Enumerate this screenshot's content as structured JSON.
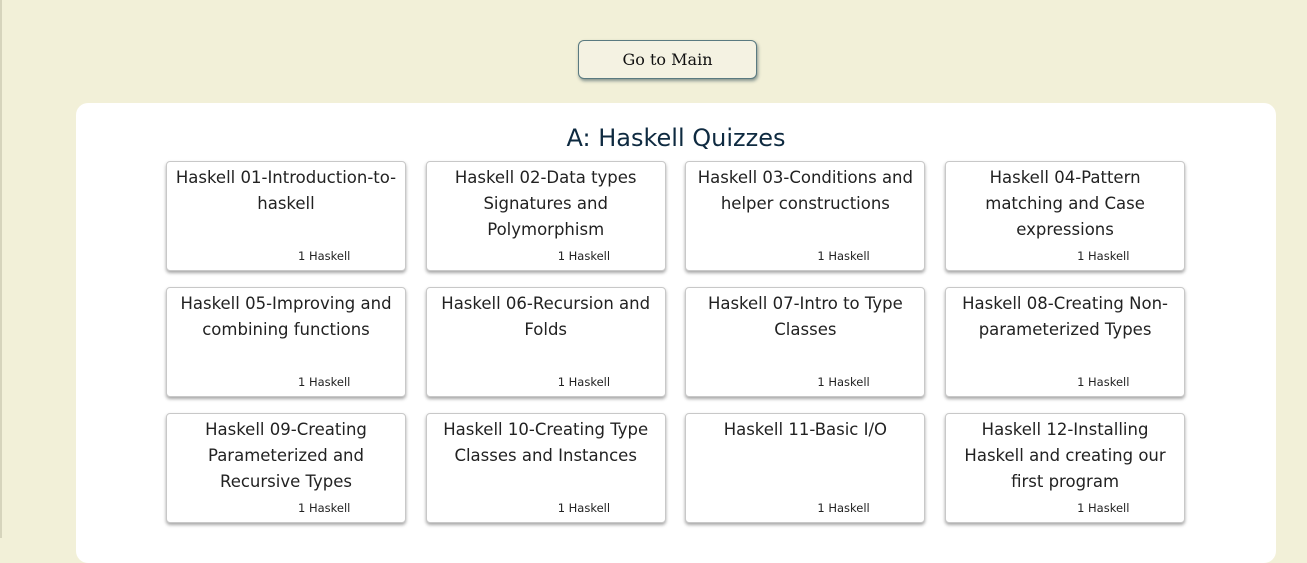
{
  "nav": {
    "main_button_label": "Go to Main"
  },
  "section": {
    "title": "A: Haskell Quizzes"
  },
  "quizzes": [
    {
      "title": "Haskell 01-Introduction-to-haskell",
      "count": "1 Haskell"
    },
    {
      "title": "Haskell 02-Data types Signatures and Polymorphism",
      "count": "1 Haskell"
    },
    {
      "title": "Haskell 03-Conditions and helper constructions",
      "count": "1 Haskell"
    },
    {
      "title": "Haskell 04-Pattern matching and Case expressions",
      "count": "1 Haskell"
    },
    {
      "title": "Haskell 05-Improving and combining functions",
      "count": "1 Haskell"
    },
    {
      "title": "Haskell 06-Recursion and Folds",
      "count": "1 Haskell"
    },
    {
      "title": "Haskell 07-Intro to Type Classes",
      "count": "1 Haskell"
    },
    {
      "title": "Haskell 08-Creating Non-parameterized Types",
      "count": "1 Haskell"
    },
    {
      "title": "Haskell 09-Creating Parameterized and Recursive Types",
      "count": "1 Haskell"
    },
    {
      "title": "Haskell 10-Creating Type Classes and Instances",
      "count": "1 Haskell"
    },
    {
      "title": "Haskell 11-Basic I/O",
      "count": "1 Haskell"
    },
    {
      "title": "Haskell 12-Installing Haskell and creating our first program",
      "count": "1 Haskell"
    }
  ],
  "colors": {
    "page_background": "#f2f0d8",
    "panel_background": "#ffffff",
    "title_text": "#0e2a40",
    "button_border": "#5a7a80"
  }
}
